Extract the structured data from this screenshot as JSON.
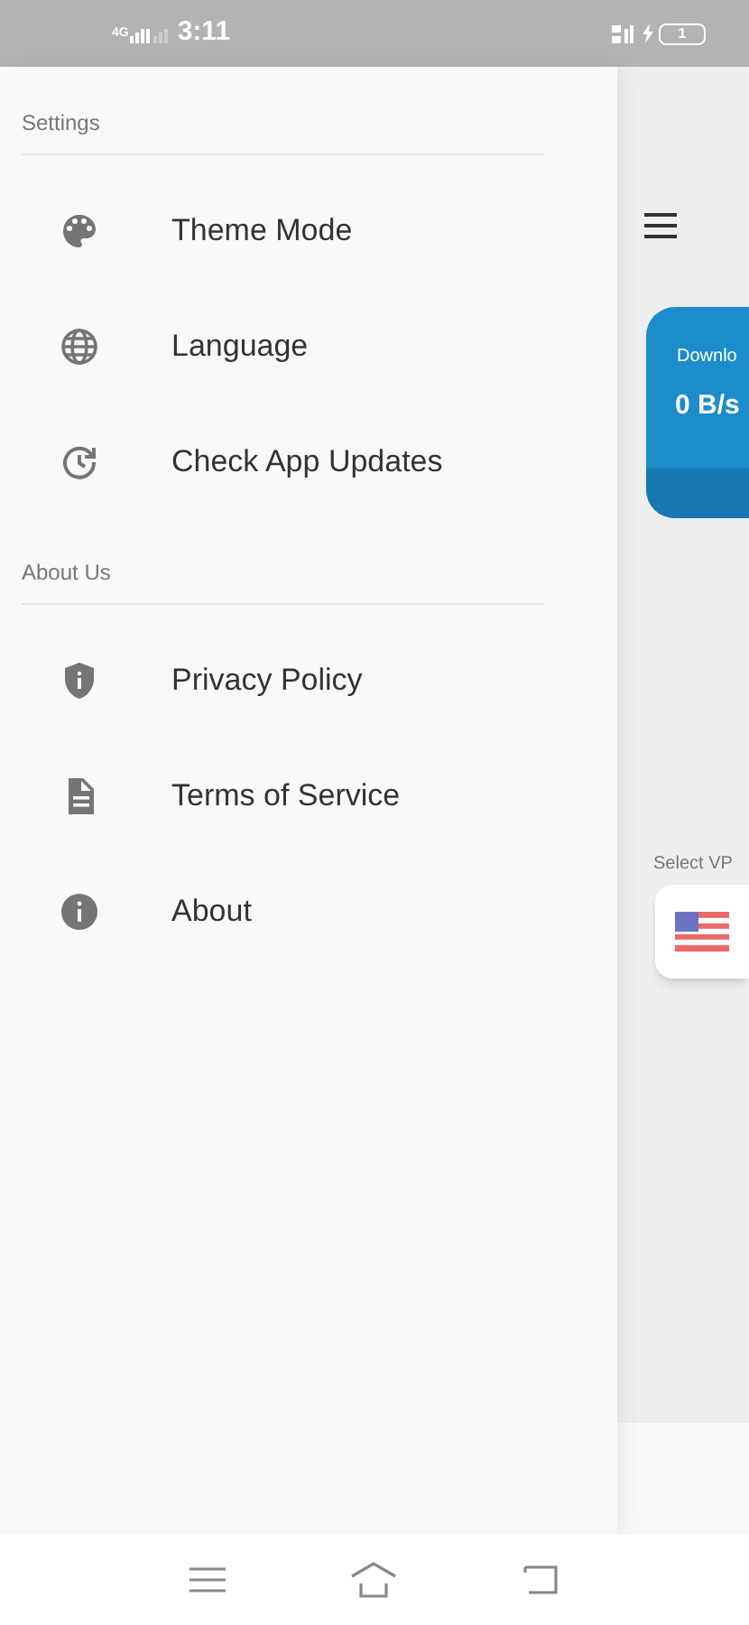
{
  "status_bar": {
    "network": "4G",
    "time": "3:11",
    "battery": "1"
  },
  "drawer": {
    "sections": [
      {
        "title": "Settings",
        "items": [
          {
            "kind": "palette",
            "label": "Theme Mode"
          },
          {
            "kind": "globe",
            "label": "Language"
          },
          {
            "kind": "update",
            "label": "Check App Updates"
          }
        ]
      },
      {
        "title": "About Us",
        "items": [
          {
            "kind": "shield",
            "label": "Privacy Policy"
          },
          {
            "kind": "document",
            "label": "Terms of Service"
          },
          {
            "kind": "info",
            "label": "About"
          }
        ]
      }
    ]
  },
  "main": {
    "download_card": {
      "label": "Downlo",
      "value": "0 B/s"
    },
    "server_label": "Select VP"
  }
}
